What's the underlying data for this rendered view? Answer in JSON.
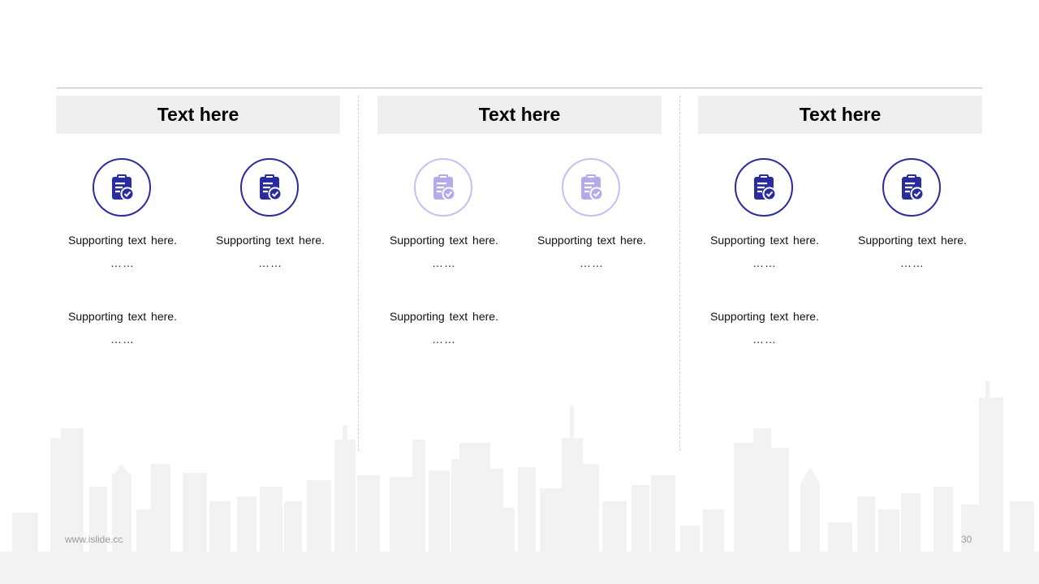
{
  "columns": [
    {
      "header": "Text here",
      "muted": false,
      "icons": [
        "clipboard-check-icon",
        "clipboard-check-icon"
      ],
      "items": [
        {
          "text": "Supporting text here.",
          "ellipsis": "……"
        },
        {
          "text": "Supporting text here.",
          "ellipsis": "……"
        },
        {
          "text": "Supporting text here.",
          "ellipsis": "……"
        }
      ]
    },
    {
      "header": "Text here",
      "muted": true,
      "icons": [
        "clipboard-check-icon",
        "clipboard-check-icon"
      ],
      "items": [
        {
          "text": "Supporting text here.",
          "ellipsis": "……"
        },
        {
          "text": "Supporting text here.",
          "ellipsis": "……"
        },
        {
          "text": "Supporting text here.",
          "ellipsis": "……"
        }
      ]
    },
    {
      "header": "Text here",
      "muted": false,
      "icons": [
        "clipboard-check-icon",
        "clipboard-check-icon"
      ],
      "items": [
        {
          "text": "Supporting text here.",
          "ellipsis": "……"
        },
        {
          "text": "Supporting text here.",
          "ellipsis": "……"
        },
        {
          "text": "Supporting text here.",
          "ellipsis": "……"
        }
      ]
    }
  ],
  "colors": {
    "accent": "#2a2ba1",
    "accent_muted": "#b7aaeb",
    "header_bg": "#efefef"
  },
  "footer": {
    "url": "www.islide.cc",
    "page_number": "30"
  }
}
